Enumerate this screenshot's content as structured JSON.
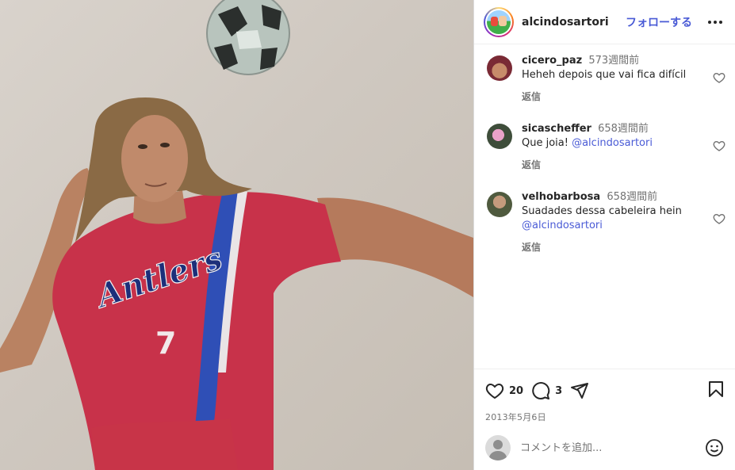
{
  "post": {
    "author": "alcindosartori",
    "follow_label": "フォローする",
    "likes": "20",
    "comment_count": "3",
    "date": "2013年5月6日",
    "photo": {
      "description_icon": "photo",
      "jersey_text": "Antlers",
      "jersey_number": "7"
    }
  },
  "comments": [
    {
      "user": "cicero_paz",
      "time": "573週間前",
      "text": "Heheh depois que vai fica difícil",
      "mention": "",
      "reply_label": "返信"
    },
    {
      "user": "sicascheffer",
      "time": "658週間前",
      "text": "Que joia! ",
      "mention": "@alcindosartori",
      "reply_label": "返信"
    },
    {
      "user": "velhobarbosa",
      "time": "658週間前",
      "text": "Suadades dessa cabeleira hein",
      "mention": "@alcindosartori",
      "reply_label": "返信"
    }
  ],
  "add_comment": {
    "placeholder": "コメントを追加..."
  },
  "colors": {
    "accent": "#4a5bd6",
    "jersey": "#c8324a",
    "stripe": "#2f4fb6"
  }
}
